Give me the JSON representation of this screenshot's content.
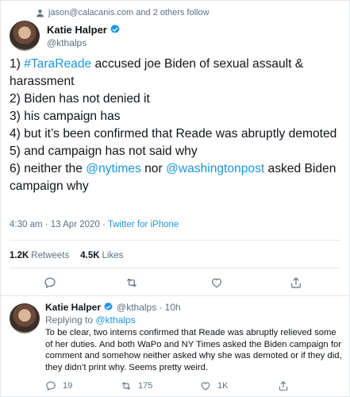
{
  "social_context": "jason@calacanis.com and 2 others follow",
  "author": {
    "name": "Katie Halper",
    "handle": "@kthalps"
  },
  "tweet": {
    "lines": [
      {
        "num": "1) ",
        "link": "#TaraReade",
        "text": " accused joe Biden of sexual assault & harassment"
      },
      {
        "text": "2) Biden has not denied it"
      },
      {
        "text": "3) his campaign has"
      },
      {
        "text": "4) but it’s been confirmed that Reade was abruptly demoted"
      },
      {
        "text": "5) and campaign has not said why"
      }
    ],
    "line6": {
      "pre": "6) neither the ",
      "link1": "@nytimes",
      "mid": " nor ",
      "link2": "@washingtonpost",
      "post": " asked Biden campaign why"
    },
    "timestamp": "4:30 am · 13 Apr 2020",
    "separator": " · ",
    "source": "Twitter for iPhone"
  },
  "stats": {
    "retweets_count": "1.2K",
    "retweets_label": "Retweets",
    "likes_count": "4.5K",
    "likes_label": "Likes"
  },
  "reply": {
    "name": "Katie Halper",
    "handle": "@kthalps",
    "time": "· 10h",
    "replying_prefix": "Replying to ",
    "replying_to": "@kthalps",
    "text": "To be clear, two interns confirmed that Reade was abruptly relieved some of her duties. And both WaPo and NY Times asked the Biden campaign for comment and somehow neither asked why she was demoted or if they did, they didn’t print why. Seems pretty weird.",
    "reply_count": "19",
    "retweet_count": "175",
    "like_count": "1K"
  },
  "colors": {
    "link": "#1b95e0",
    "secondary": "#5b7083",
    "border": "#e1e8ed",
    "text": "#0f1419"
  }
}
